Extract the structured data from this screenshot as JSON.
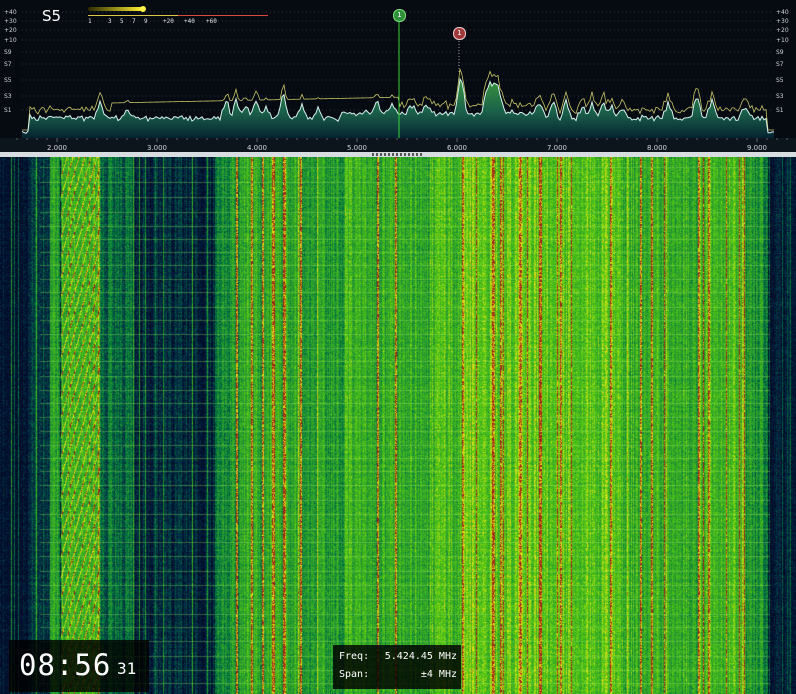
{
  "spectrum": {
    "smeter_reading": "S5",
    "meter_ticks": [
      "1",
      "3",
      "5",
      "7",
      "9",
      "+20",
      "+40",
      "+60"
    ],
    "db_labels": [
      "+40",
      "+30",
      "+20",
      "+10",
      "S9",
      "S7",
      "S5",
      "S3",
      "S1"
    ],
    "freq_labels": [
      "2.000",
      "3.000",
      "4.000",
      "5.000",
      "6.000",
      "7.000",
      "8.000",
      "9.000"
    ],
    "marker_1_label": "1",
    "marker_2_label": "1"
  },
  "info": {
    "freq_label": "Freq:",
    "freq_value": "5.424.45 MHz",
    "span_label": "Span:",
    "span_value": "±4 MHz"
  },
  "clock": {
    "hours_minutes": "08:56",
    "seconds": "31"
  },
  "colors": {
    "trace": "#d7f2f0",
    "peak_hold": "#c7c466",
    "fill_top": "#3d9c3c",
    "fill_bottom": "#062433",
    "marker_green": "#2f8f3a",
    "marker_red": "#a13a3a"
  }
}
